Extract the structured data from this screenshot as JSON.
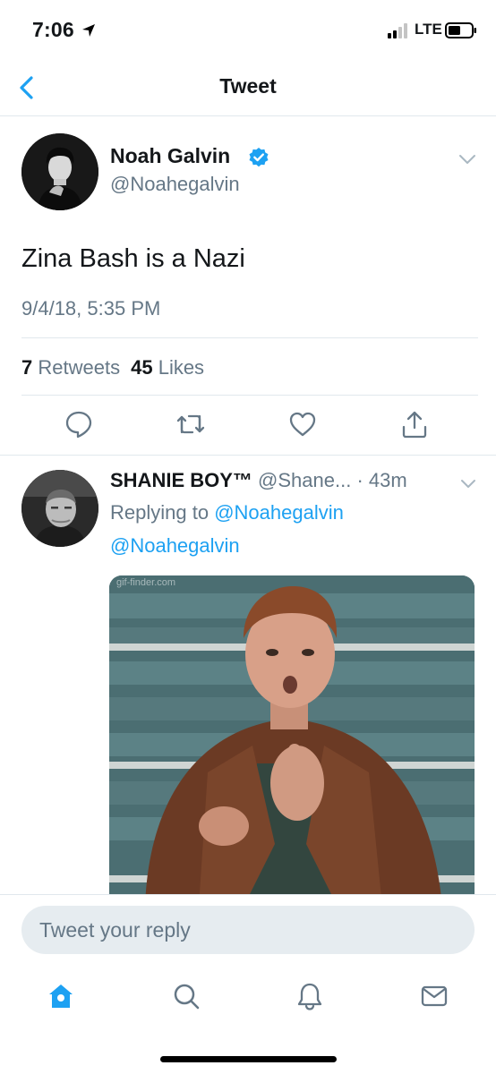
{
  "status_bar": {
    "time": "7:06",
    "network": "LTE"
  },
  "header": {
    "title": "Tweet"
  },
  "main_tweet": {
    "author_name": "Noah Galvin",
    "author_handle": "@Noahegalvin",
    "text": "Zina Bash is a Nazi",
    "timestamp": "9/4/18, 5:35 PM",
    "retweets_count": "7",
    "retweets_label": "Retweets",
    "likes_count": "45",
    "likes_label": "Likes"
  },
  "reply": {
    "author_name": "SHANIE BOY™",
    "author_handle": "@Shane...",
    "age": "· 43m",
    "replying_to_label": "Replying to",
    "replying_to_1": "@Noahegalvin",
    "replying_to_2": "@Noahegalvin",
    "gif_watermark": "gif-finder.com"
  },
  "reply_composer": {
    "placeholder": "Tweet your reply"
  },
  "colors": {
    "accent": "#1da1f2",
    "secondary_text": "#657786",
    "divider": "#e1e8ed"
  },
  "icons": {
    "status": [
      "location-arrow-icon",
      "signal-icon",
      "battery-icon"
    ],
    "actions": [
      "reply-icon",
      "retweet-icon",
      "like-icon",
      "share-icon"
    ],
    "tabs": [
      "home-icon",
      "search-icon",
      "notifications-icon",
      "messages-icon"
    ]
  }
}
